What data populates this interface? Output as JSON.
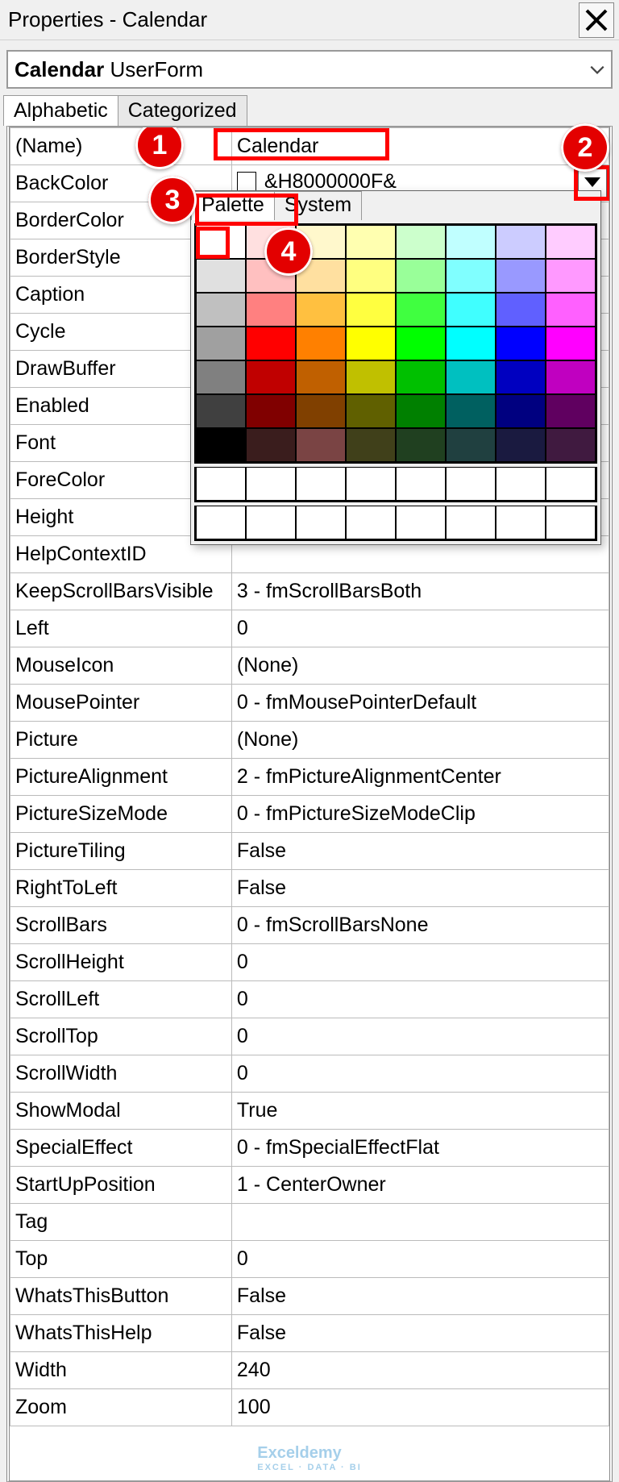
{
  "title": "Properties - Calendar",
  "objectSelector": {
    "name": "Calendar",
    "type": "UserForm"
  },
  "tabs": {
    "alphabetic": "Alphabetic",
    "categorized": "Categorized"
  },
  "coltabs": {
    "palette": "Palette",
    "system": "System"
  },
  "props": [
    {
      "n": "(Name)",
      "v": "Calendar"
    },
    {
      "n": "BackColor",
      "v": "&H8000000F&",
      "color": true
    },
    {
      "n": "BorderColor",
      "v": ""
    },
    {
      "n": "BorderStyle",
      "v": ""
    },
    {
      "n": "Caption",
      "v": ""
    },
    {
      "n": "Cycle",
      "v": ""
    },
    {
      "n": "DrawBuffer",
      "v": ""
    },
    {
      "n": "Enabled",
      "v": ""
    },
    {
      "n": "Font",
      "v": ""
    },
    {
      "n": "ForeColor",
      "v": ""
    },
    {
      "n": "Height",
      "v": ""
    },
    {
      "n": "HelpContextID",
      "v": ""
    },
    {
      "n": "KeepScrollBarsVisible",
      "v": "3 - fmScrollBarsBoth"
    },
    {
      "n": "Left",
      "v": "0"
    },
    {
      "n": "MouseIcon",
      "v": "(None)"
    },
    {
      "n": "MousePointer",
      "v": "0 - fmMousePointerDefault"
    },
    {
      "n": "Picture",
      "v": "(None)"
    },
    {
      "n": "PictureAlignment",
      "v": "2 - fmPictureAlignmentCenter"
    },
    {
      "n": "PictureSizeMode",
      "v": "0 - fmPictureSizeModeClip"
    },
    {
      "n": "PictureTiling",
      "v": "False"
    },
    {
      "n": "RightToLeft",
      "v": "False"
    },
    {
      "n": "ScrollBars",
      "v": "0 - fmScrollBarsNone"
    },
    {
      "n": "ScrollHeight",
      "v": "0"
    },
    {
      "n": "ScrollLeft",
      "v": "0"
    },
    {
      "n": "ScrollTop",
      "v": "0"
    },
    {
      "n": "ScrollWidth",
      "v": "0"
    },
    {
      "n": "ShowModal",
      "v": "True"
    },
    {
      "n": "SpecialEffect",
      "v": "0 - fmSpecialEffectFlat"
    },
    {
      "n": "StartUpPosition",
      "v": "1 - CenterOwner"
    },
    {
      "n": "Tag",
      "v": ""
    },
    {
      "n": "Top",
      "v": "0"
    },
    {
      "n": "WhatsThisButton",
      "v": "False"
    },
    {
      "n": "WhatsThisHelp",
      "v": "False"
    },
    {
      "n": "Width",
      "v": "240"
    },
    {
      "n": "Zoom",
      "v": "100"
    }
  ],
  "palette": [
    [
      "#ffffff",
      "#ffe0e0",
      "#fff8cc",
      "#ffffb0",
      "#ccffcc",
      "#c0ffff",
      "#ccccff",
      "#ffccff"
    ],
    [
      "#e0e0e0",
      "#ffc0c0",
      "#ffe0a0",
      "#ffff80",
      "#99ff99",
      "#80ffff",
      "#9999ff",
      "#ff99ff"
    ],
    [
      "#c0c0c0",
      "#ff8080",
      "#ffc040",
      "#ffff40",
      "#40ff40",
      "#40ffff",
      "#6060ff",
      "#ff60ff"
    ],
    [
      "#a0a0a0",
      "#ff0000",
      "#ff8000",
      "#ffff00",
      "#00ff00",
      "#00ffff",
      "#0000ff",
      "#ff00ff"
    ],
    [
      "#808080",
      "#c00000",
      "#c06000",
      "#c0c000",
      "#00c000",
      "#00c0c0",
      "#0000c0",
      "#c000c0"
    ],
    [
      "#404040",
      "#800000",
      "#804000",
      "#606000",
      "#008000",
      "#006060",
      "#000080",
      "#600060"
    ],
    [
      "#000000",
      "#3a1d1d",
      "#7a4444",
      "#40401a",
      "#204020",
      "#204040",
      "#1a1a40",
      "#401a40"
    ]
  ],
  "callouts": {
    "1": "1",
    "2": "2",
    "3": "3",
    "4": "4"
  },
  "watermark": {
    "brand": "Exceldemy",
    "sub": "EXCEL · DATA · BI"
  }
}
